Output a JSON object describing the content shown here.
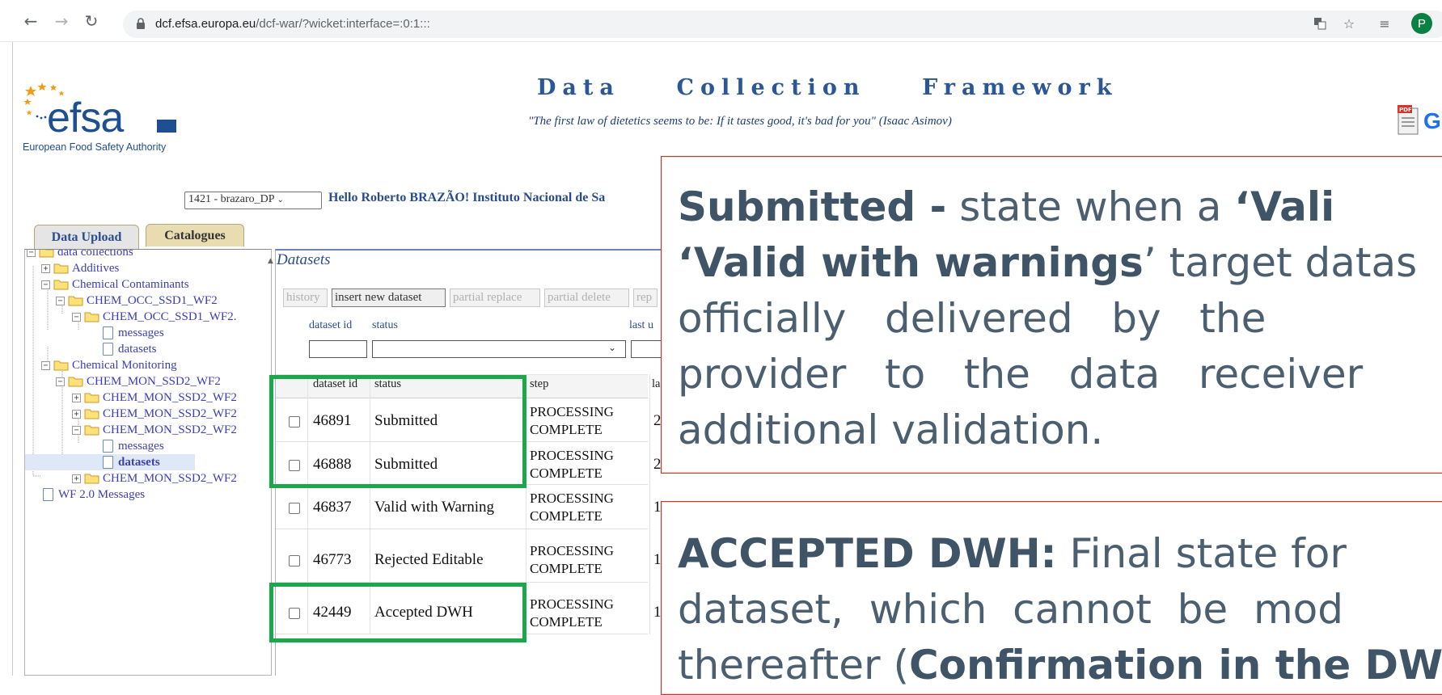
{
  "browser": {
    "url_host": "dcf.efsa.europa.eu",
    "url_path": "/dcf-war/?wicket:interface=:0:1:::",
    "profile_initial": "P"
  },
  "header": {
    "logo_text": "efsa",
    "logo_tagline": "European Food Safety Authority",
    "title": "Data    Collection    Framework",
    "quote": "\"The first law of dietetics seems to be: If it tastes good, it's bad for you\" (Isaac Asimov)",
    "help_letter": "G"
  },
  "user_bar": {
    "selected_profile": "1421 - brazaro_DP",
    "greeting": "Hello Roberto BRAZÃO! Instituto Nacional de Sa"
  },
  "tabs": [
    {
      "label": "Data Upload",
      "active": true
    },
    {
      "label": "Catalogues",
      "active": false
    }
  ],
  "tree": {
    "items": [
      {
        "label": "data collections"
      },
      {
        "label": "Additives"
      },
      {
        "label": "Chemical Contaminants"
      },
      {
        "label": "CHEM_OCC_SSD1_WF2"
      },
      {
        "label": "CHEM_OCC_SSD1_WF2."
      },
      {
        "label": "messages"
      },
      {
        "label": "datasets"
      },
      {
        "label": "Chemical Monitoring"
      },
      {
        "label": "CHEM_MON_SSD2_WF2"
      },
      {
        "label": "CHEM_MON_SSD2_WF2"
      },
      {
        "label": "CHEM_MON_SSD2_WF2"
      },
      {
        "label": "CHEM_MON_SSD2_WF2"
      },
      {
        "label": "messages"
      },
      {
        "label": "datasets"
      },
      {
        "label": "CHEM_MON_SSD2_WF2"
      },
      {
        "label": "WF 2.0 Messages"
      }
    ]
  },
  "datasets": {
    "title": "Datasets",
    "toolbar": [
      {
        "label": "history",
        "enabled": false
      },
      {
        "label": "insert new dataset",
        "enabled": true
      },
      {
        "label": "partial replace",
        "enabled": false
      },
      {
        "label": "partial delete",
        "enabled": false
      },
      {
        "label": "rep",
        "enabled": false
      }
    ],
    "filter_labels": {
      "dataset_id": "dataset id",
      "status": "status",
      "last": "last u"
    },
    "columns": {
      "id": "dataset id",
      "status": "status",
      "step": "step",
      "last": "la"
    },
    "rows": [
      {
        "id": "46891",
        "status": "Submitted",
        "step1": "PROCESSING",
        "step2": "COMPLETE",
        "last": "2"
      },
      {
        "id": "46888",
        "status": "Submitted",
        "step1": "PROCESSING",
        "step2": "COMPLETE",
        "last": "2"
      },
      {
        "id": "46837",
        "status": "Valid with Warning",
        "step1": "PROCESSING",
        "step2": "COMPLETE",
        "last": "1"
      },
      {
        "id": "46773",
        "status": "Rejected Editable",
        "step1": "PROCESSING",
        "step2": "COMPLETE",
        "last": "1"
      },
      {
        "id": "42449",
        "status": "Accepted DWH",
        "step1": "PROCESSING",
        "step2": "COMPLETE",
        "last": "1"
      }
    ]
  },
  "callouts": {
    "submitted": {
      "l1_bold": "Submitted -",
      "l1_rest": " state when a ",
      "l1_bold2": "‘Vali",
      "l2_bold": "‘Valid with warnings",
      "l2_rest": "’ target datas",
      "l3": "officially   delivered   by   the",
      "l4": "provider   to   the   data   receiver",
      "l5": "additional validation."
    },
    "accepted": {
      "l1_bold": "ACCEPTED DWH:",
      "l1_rest": " Final state for",
      "l2": "dataset,  which  cannot  be  mod",
      "l3_rest": "thereafter (",
      "l3_bold": "Confirmation in the DW"
    }
  },
  "colors": {
    "highlight": "#1aa84b",
    "callout_border": "#c0392b",
    "callout_text": "#4b5f70",
    "title": "#2b5797"
  }
}
